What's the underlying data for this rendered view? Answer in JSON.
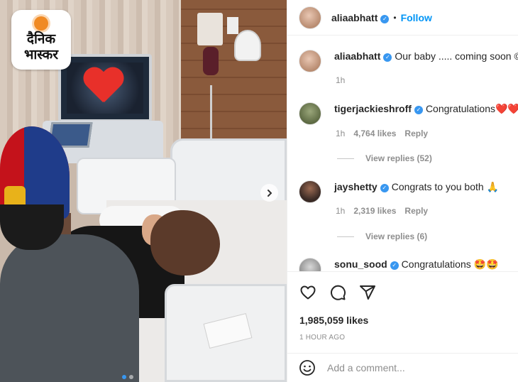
{
  "logo": {
    "line1": "दैनिक",
    "line2": "भास्कर"
  },
  "post": {
    "author": "aliaabhatt",
    "follow_label": "Follow",
    "caption": "Our baby ..... coming soon ©",
    "caption_time": "1h",
    "likes": "1,985,059 likes",
    "posted_ago": "1 HOUR AGO",
    "carousel_dots": 2,
    "active_dot": 0,
    "overlay_emoji": "heart"
  },
  "comments": [
    {
      "user": "tigerjackieshroff",
      "text": "Congratulations❤️❤️",
      "time": "1h",
      "likes": "4,764 likes",
      "reply_label": "Reply",
      "view_replies": "View replies (52)"
    },
    {
      "user": "jayshetty",
      "text": "Congrats to you both 🙏",
      "time": "1h",
      "likes": "2,319 likes",
      "reply_label": "Reply",
      "view_replies": "View replies (6)"
    },
    {
      "user": "sonu_sood",
      "text": "Congratulations 🤩🤩"
    }
  ],
  "add_comment": {
    "placeholder": "Add a comment..."
  },
  "icons": {
    "like": "heart-outline-icon",
    "comment": "speech-bubble-icon",
    "share": "paper-plane-icon",
    "emoji": "smiley-icon",
    "next": "chevron-right-icon",
    "verified": "verified-badge-icon"
  },
  "colors": {
    "accent": "#0095f6",
    "verified": "#3897f0",
    "muted": "#8e8e8e",
    "text": "#262626"
  }
}
